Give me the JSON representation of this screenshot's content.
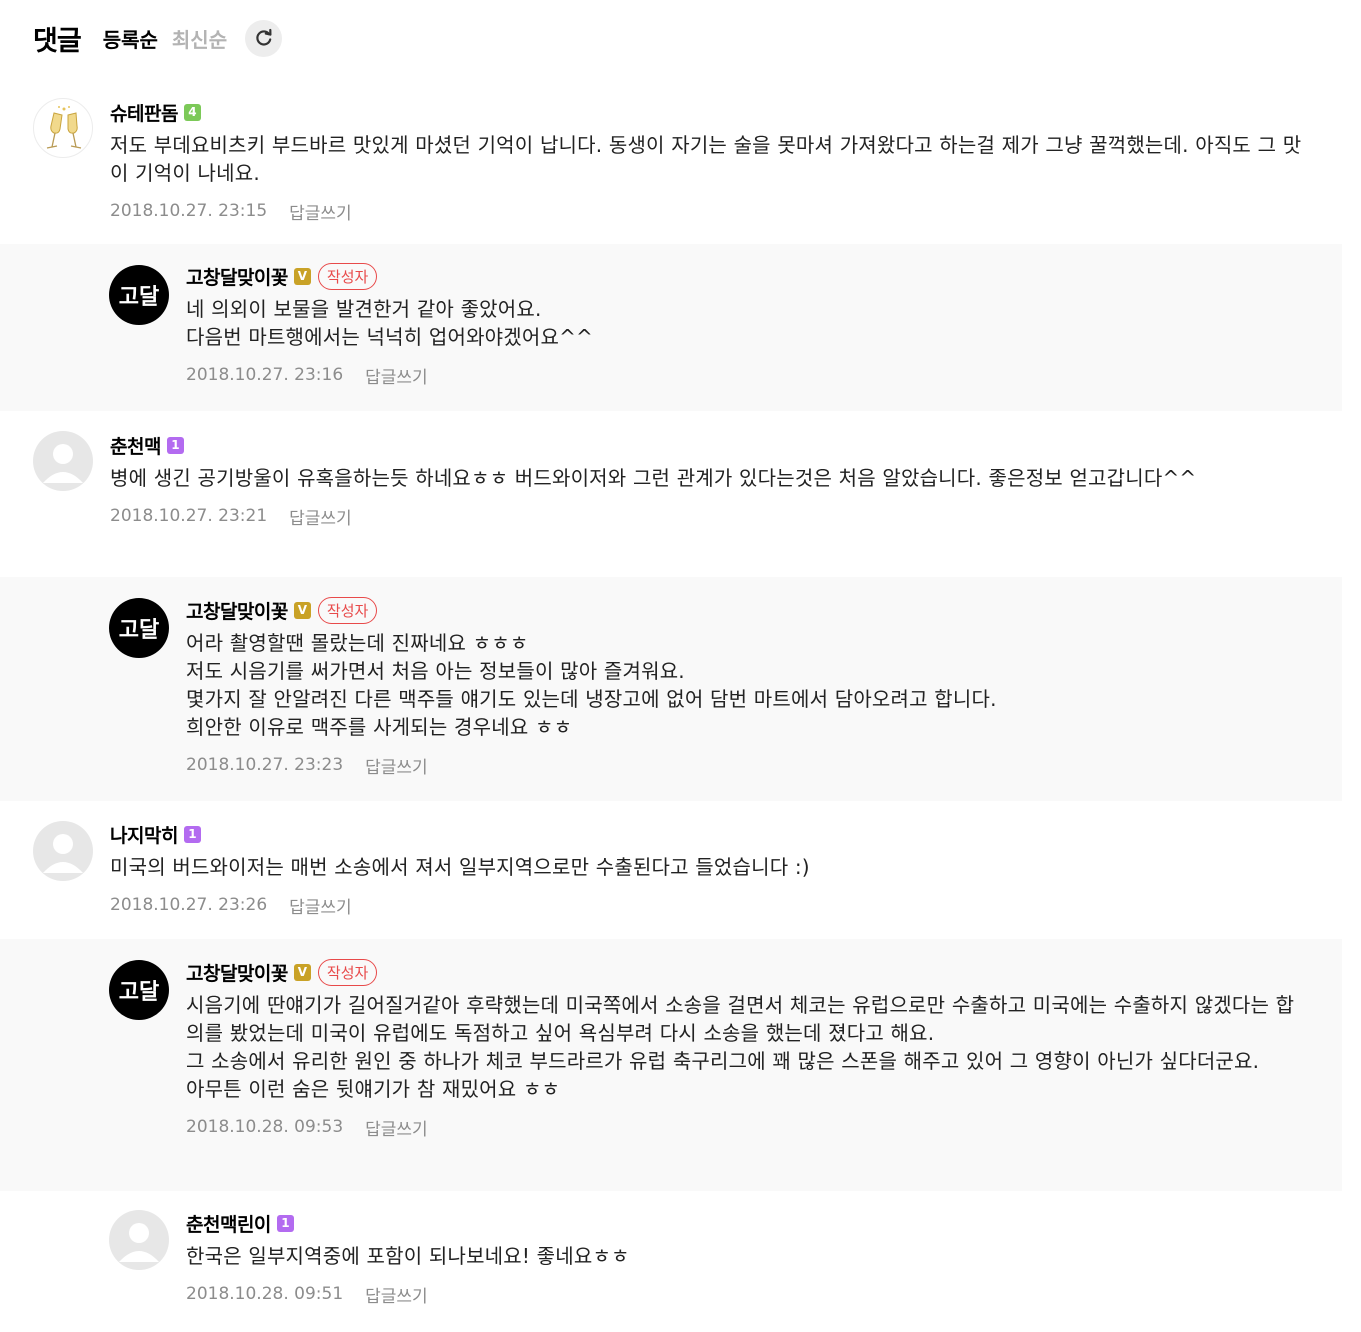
{
  "header": {
    "title": "댓글",
    "sort_registered": "등록순",
    "sort_latest": "최신순"
  },
  "comments": [
    {
      "nick": "슈테판돔",
      "level": "4",
      "text": "저도 부데요비츠키 부드바르 맛있게 마셨던 기억이 납니다. 동생이 자기는 술을 못마셔 가져왔다고 하는걸 제가 그냥 꿀꺽했는데. 아직도 그 맛이 기억이 나네요.",
      "date": "2018.10.27. 23:15",
      "reply_label": "답글쓰기"
    },
    {
      "nick": "고창달맞이꽃",
      "level": "V",
      "badge": "작성자",
      "logo_text": "고달",
      "text": "네 의외이 보물을 발견한거 같아 좋았어요.\n다음번 마트행에서는 넉넉히 업어와야겠어요^^",
      "date": "2018.10.27. 23:16",
      "reply_label": "답글쓰기"
    },
    {
      "nick": "춘천맥",
      "level": "1",
      "text": "병에 생긴 공기방울이 유혹을하는듯 하네요ㅎㅎ 버드와이저와 그런 관계가 있다는것은 처음 알았습니다. 좋은정보 얻고갑니다^^",
      "date": "2018.10.27. 23:21",
      "reply_label": "답글쓰기"
    },
    {
      "nick": "고창달맞이꽃",
      "level": "V",
      "badge": "작성자",
      "logo_text": "고달",
      "text": "어라 촬영할땐 몰랐는데 진짜네요 ㅎㅎㅎ\n저도 시음기를 써가면서 처음 아는 정보들이 많아 즐겨워요.\n몇가지 잘 안알려진 다른 맥주들 얘기도 있는데 냉장고에 없어 담번 마트에서 담아오려고 합니다.\n희안한 이유로 맥주를 사게되는 경우네요 ㅎㅎ",
      "date": "2018.10.27. 23:23",
      "reply_label": "답글쓰기"
    },
    {
      "nick": "나지막히",
      "level": "1",
      "text": "미국의 버드와이저는 매번 소송에서 져서 일부지역으로만 수출된다고 들었습니다 :)",
      "date": "2018.10.27. 23:26",
      "reply_label": "답글쓰기"
    },
    {
      "nick": "고창달맞이꽃",
      "level": "V",
      "badge": "작성자",
      "logo_text": "고달",
      "text": "시음기에 딴얘기가 길어질거같아 후략했는데 미국쪽에서 소송을 걸면서 체코는 유럽으로만 수출하고 미국에는 수출하지 않겠다는 합의를 봤었는데 미국이 유럽에도 독점하고 싶어 욕심부려 다시 소송을 했는데 졌다고 해요.\n그 소송에서 유리한 원인 중 하나가 체코 부드라르가 유럽 축구리그에 꽤 많은 스폰을 해주고 있어 그 영향이 아닌가 싶다더군요.\n아무튼 이런 숨은 뒷얘기가 참 재밌어요 ㅎㅎ",
      "date": "2018.10.28. 09:53",
      "reply_label": "답글쓰기"
    },
    {
      "nick": "춘천맥린이",
      "level": "1",
      "text": "한국은 일부지역중에 포함이 되나보네요! 좋네요ㅎㅎ",
      "date": "2018.10.28. 09:51",
      "reply_label": "답글쓰기"
    }
  ]
}
